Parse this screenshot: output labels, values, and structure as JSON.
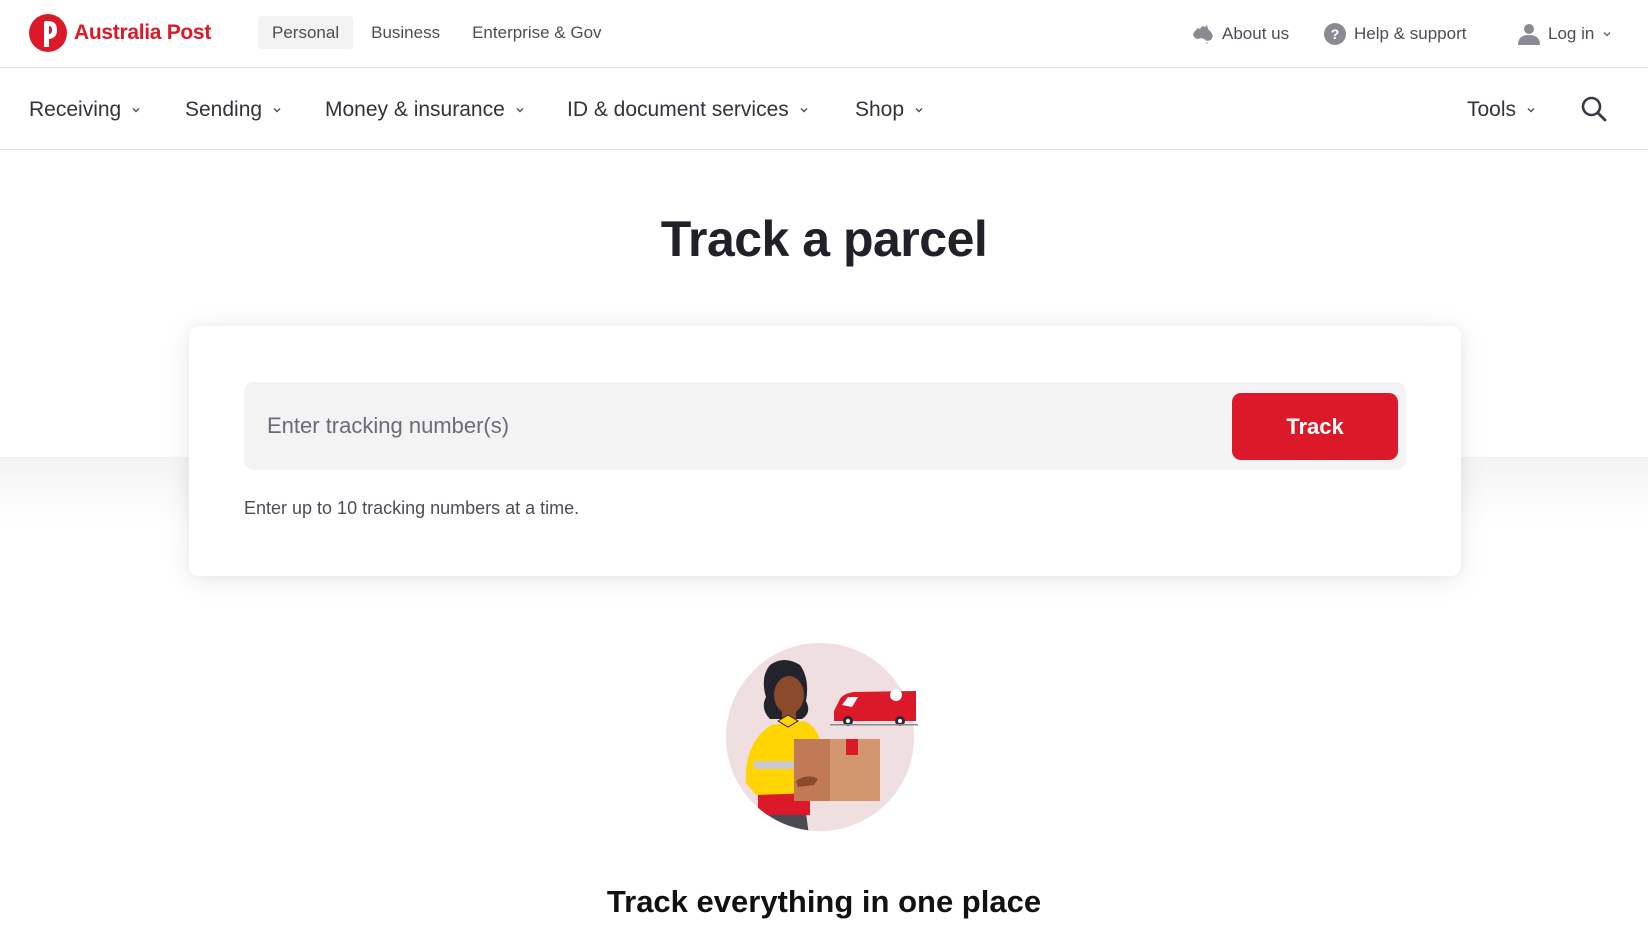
{
  "brand": {
    "name": "Australia Post",
    "color": "#dc1928"
  },
  "topbar": {
    "segments": [
      {
        "label": "Personal",
        "active": true
      },
      {
        "label": "Business",
        "active": false
      },
      {
        "label": "Enterprise & Gov",
        "active": false
      }
    ],
    "utility": {
      "about": {
        "label": "About us",
        "icon": "australia-map-icon"
      },
      "help": {
        "label": "Help & support",
        "icon": "question-circle-icon"
      },
      "login": {
        "label": "Log in",
        "icon": "user-icon"
      }
    }
  },
  "mainnav": {
    "items": [
      {
        "label": "Receiving"
      },
      {
        "label": "Sending"
      },
      {
        "label": "Money & insurance"
      },
      {
        "label": "ID & document services"
      },
      {
        "label": "Shop"
      }
    ],
    "tools": {
      "label": "Tools"
    },
    "search": {
      "icon": "search-icon"
    }
  },
  "hero": {
    "title": "Track a parcel",
    "input": {
      "placeholder": "Enter tracking number(s)",
      "value": ""
    },
    "button": "Track",
    "hint": "Enter up to 10 tracking numbers at a time."
  },
  "section": {
    "illustration": "person-holding-parcel-with-van",
    "heading": "Track everything in one place"
  }
}
